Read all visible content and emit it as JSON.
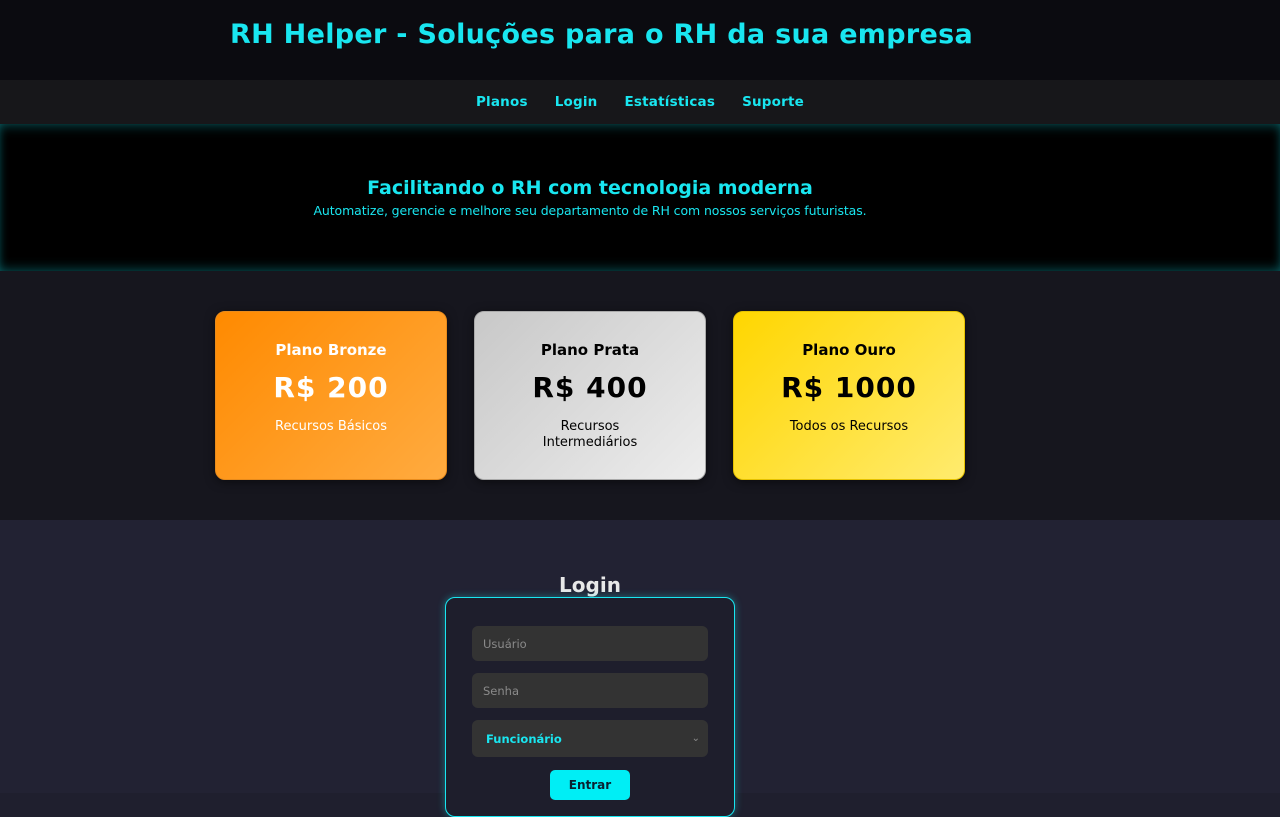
{
  "header": {
    "title": "RH Helper - Soluções para o RH da sua empresa"
  },
  "nav": {
    "items": [
      "Planos",
      "Login",
      "Estatísticas",
      "Suporte"
    ]
  },
  "hero": {
    "title": "Facilitando o RH com tecnologia moderna",
    "subtitle": "Automatize, gerencie e melhore seu departamento de RH com nossos serviços futuristas."
  },
  "plans": [
    {
      "name": "Plano Bronze",
      "price": "R$ 200",
      "description": "Recursos Básicos",
      "color": "#ff8a00"
    },
    {
      "name": "Plano Prata",
      "price": "R$ 400",
      "description": "Recursos Intermediários",
      "color": "#d0d0d0"
    },
    {
      "name": "Plano Ouro",
      "price": "R$ 1000",
      "description": "Todos os Recursos",
      "color": "#ffd600"
    }
  ],
  "login": {
    "title": "Login",
    "username_placeholder": "Usuário",
    "username_value": "",
    "password_placeholder": "Senha",
    "password_value": "",
    "role_selected": "Funcionário",
    "submit_label": "Entrar"
  },
  "colors": {
    "accent": "#19e6f0",
    "background": "#1f1f2e"
  },
  "icons": {
    "select_arrow": "chevron-down-icon"
  }
}
